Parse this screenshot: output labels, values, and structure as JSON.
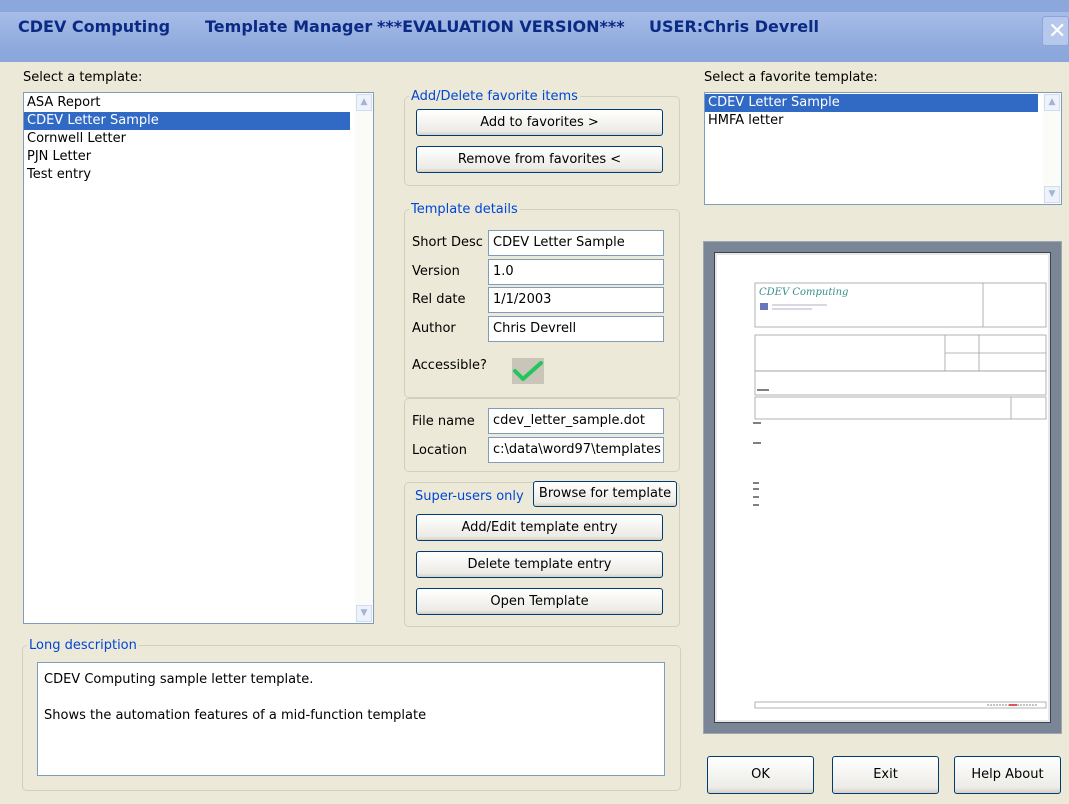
{
  "titlebar": {
    "company": "CDEV Computing",
    "app": "Template Manager",
    "edition": "***EVALUATION VERSION***",
    "user": "USER:Chris Devrell"
  },
  "templates": {
    "label": "Select a template:",
    "items": [
      "ASA Report",
      "CDEV Letter Sample",
      "Cornwell Letter",
      "PJN Letter",
      "Test entry"
    ],
    "selected_index": 1
  },
  "favorites_group": {
    "legend": "Add/Delete favorite items",
    "add_label": "Add to favorites >",
    "remove_label": "Remove from favorites <"
  },
  "details": {
    "legend": "Template details",
    "short_desc_label": "Short Desc",
    "short_desc_value": "CDEV Letter Sample",
    "version_label": "Version",
    "version_value": "1.0",
    "rel_date_label": "Rel date",
    "rel_date_value": "1/1/2003",
    "author_label": "Author",
    "author_value": "Chris Devrell",
    "accessible_label": "Accessible?"
  },
  "file": {
    "name_label": "File name",
    "name_value": "cdev_letter_sample.dot",
    "location_label": "Location",
    "location_value": "c:\\data\\word97\\templates"
  },
  "superusers": {
    "legend": "Super-users only",
    "browse_label": "Browse for template",
    "add_edit_label": "Add/Edit template entry",
    "delete_label": "Delete template entry",
    "open_label": "Open Template"
  },
  "favorites": {
    "label": "Select a favorite template:",
    "items": [
      "CDEV Letter Sample",
      "HMFA letter"
    ],
    "selected_index": 0
  },
  "preview": {
    "logo_text": "CDEV Computing"
  },
  "long_description": {
    "legend": "Long description",
    "line1": "CDEV Computing sample letter template.",
    "line2": "Shows the automation features of a mid-function template"
  },
  "buttons": {
    "ok": "OK",
    "exit": "Exit",
    "help": "Help About"
  },
  "colors": {
    "selection": "#316AC5",
    "group_legend": "#0046D5",
    "title_text": "#0B2A84",
    "accessible_check": "#22C55E"
  }
}
